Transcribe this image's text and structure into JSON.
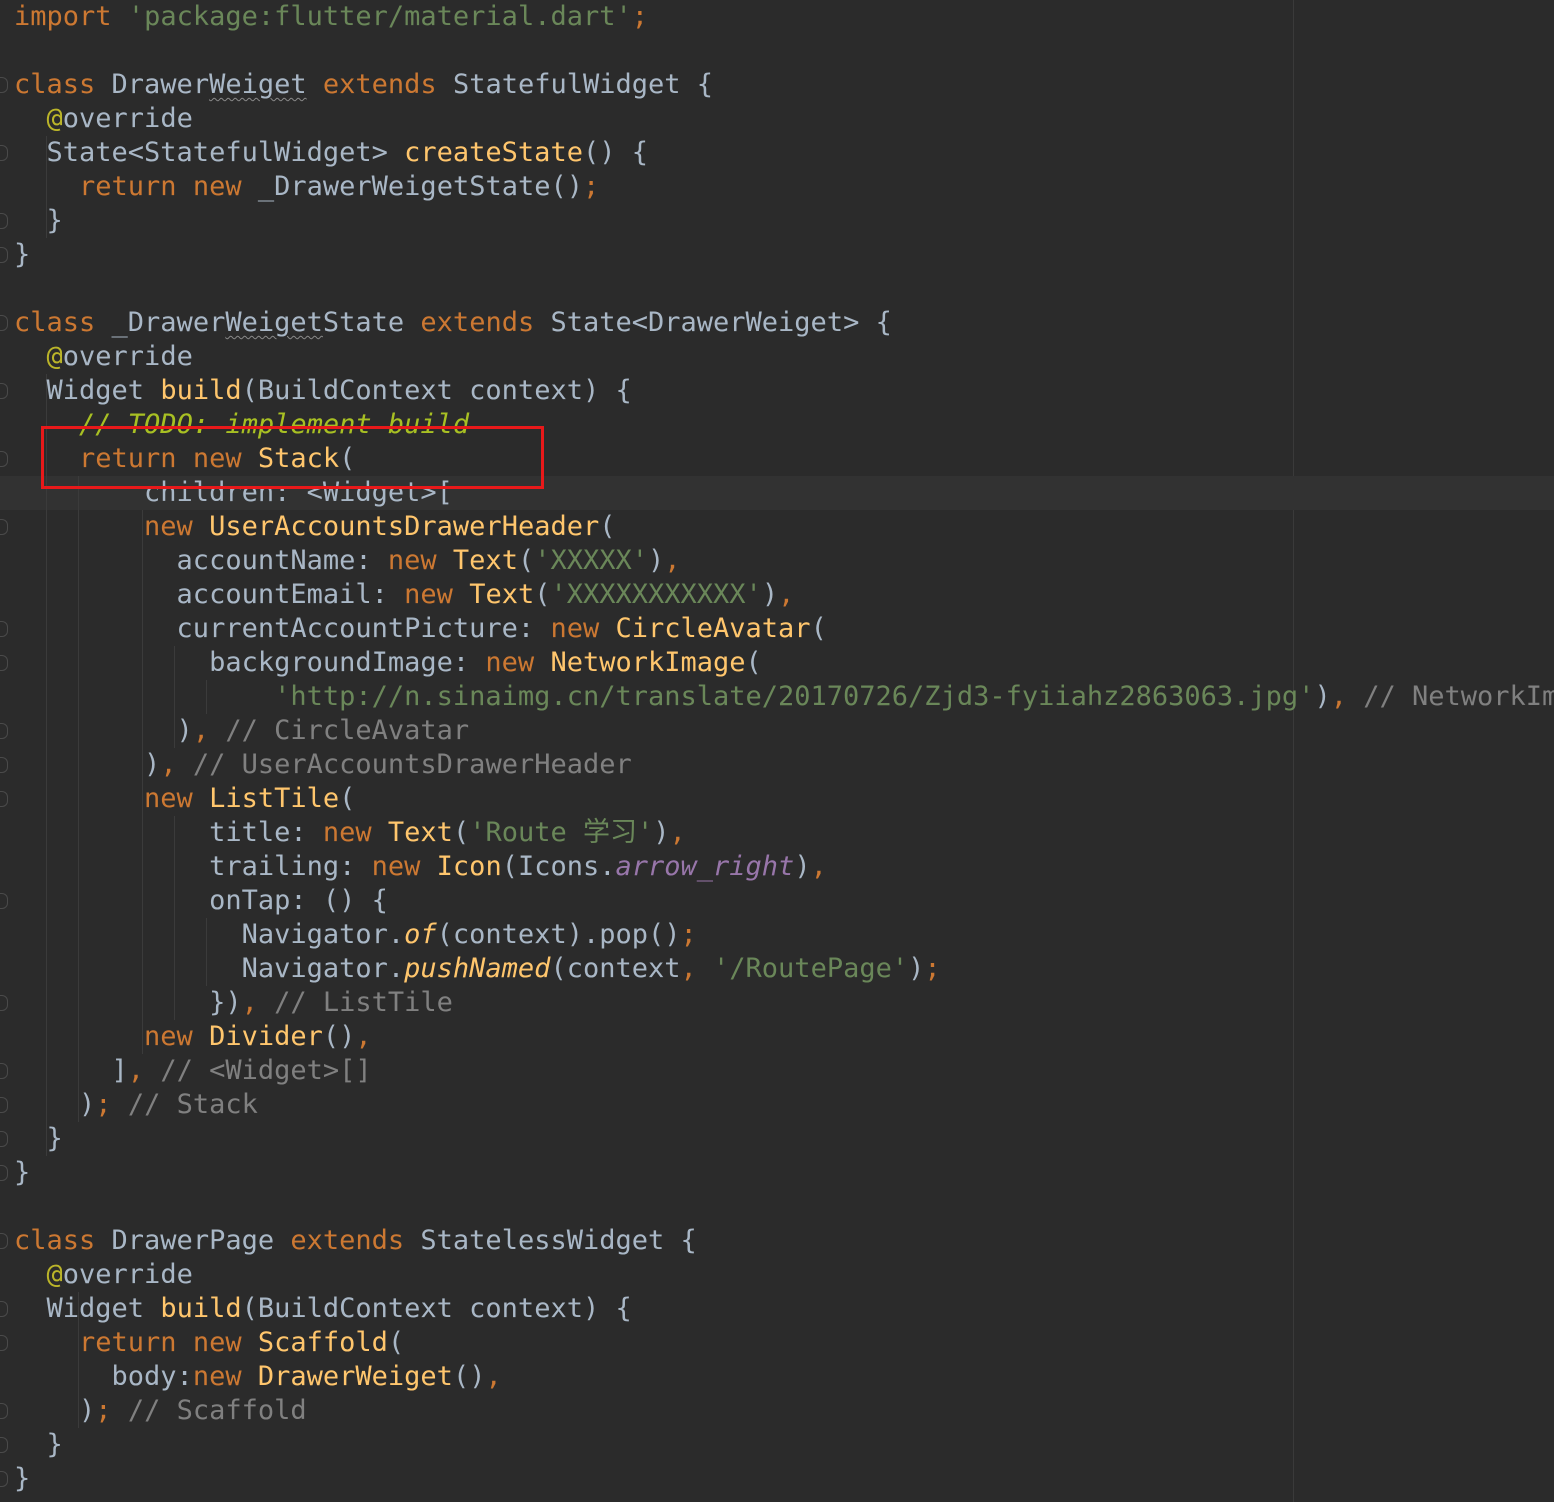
{
  "editor": {
    "language": "dart",
    "colors": {
      "background": "#2b2b2b",
      "keyword": "#cc7832",
      "string": "#6a8759",
      "comment": "#808080",
      "annotation": "#bbb529",
      "function": "#ffc66d",
      "todo": "#a8c023",
      "field": "#9876aa",
      "plain": "#a9b7c6",
      "highlight_box": "#e8191a"
    },
    "lines": [
      [
        {
          "t": "import",
          "c": "kw"
        },
        {
          "t": " "
        },
        {
          "t": "'package:flutter/material.dart'",
          "c": "str"
        },
        {
          "t": ";",
          "c": "kw"
        }
      ],
      [],
      [
        {
          "t": "class",
          "c": "kw"
        },
        {
          "t": " Drawer"
        },
        {
          "t": "Weiget",
          "c": "ul"
        },
        {
          "t": " "
        },
        {
          "t": "extends",
          "c": "kw"
        },
        {
          "t": " StatefulWidget {"
        }
      ],
      [
        {
          "t": "  "
        },
        {
          "t": "@",
          "c": "ann"
        },
        {
          "t": "override"
        }
      ],
      [
        {
          "t": "  State<StatefulWidget> "
        },
        {
          "t": "createState",
          "c": "fn"
        },
        {
          "t": "() {"
        }
      ],
      [
        {
          "t": "    "
        },
        {
          "t": "return",
          "c": "kw"
        },
        {
          "t": " "
        },
        {
          "t": "new",
          "c": "kw"
        },
        {
          "t": " _DrawerWeigetState()"
        },
        {
          "t": ";",
          "c": "kw"
        }
      ],
      [
        {
          "t": "  }"
        }
      ],
      [
        {
          "t": "}"
        }
      ],
      [],
      [
        {
          "t": "class",
          "c": "kw"
        },
        {
          "t": " _Drawer"
        },
        {
          "t": "Weiget",
          "c": "ul"
        },
        {
          "t": "State "
        },
        {
          "t": "extends",
          "c": "kw"
        },
        {
          "t": " State<DrawerWeiget> {"
        }
      ],
      [
        {
          "t": "  "
        },
        {
          "t": "@",
          "c": "ann"
        },
        {
          "t": "override"
        }
      ],
      [
        {
          "t": "  Widget "
        },
        {
          "t": "build",
          "c": "fn"
        },
        {
          "t": "(BuildContext context) {"
        }
      ],
      [
        {
          "t": "    "
        },
        {
          "t": "// TODO: implement build",
          "c": "todo"
        }
      ],
      [
        {
          "t": "    "
        },
        {
          "t": "return",
          "c": "kw"
        },
        {
          "t": " "
        },
        {
          "t": "new",
          "c": "kw"
        },
        {
          "t": " "
        },
        {
          "t": "Stack",
          "c": "fn"
        },
        {
          "t": "("
        }
      ],
      [
        {
          "t": "        children: <Widget>["
        }
      ],
      [
        {
          "t": "        "
        },
        {
          "t": "new",
          "c": "kw"
        },
        {
          "t": " "
        },
        {
          "t": "UserAccountsDrawerHeader",
          "c": "fn"
        },
        {
          "t": "("
        }
      ],
      [
        {
          "t": "          accountName: "
        },
        {
          "t": "new",
          "c": "kw"
        },
        {
          "t": " "
        },
        {
          "t": "Text",
          "c": "fn"
        },
        {
          "t": "("
        },
        {
          "t": "'XXXXX'",
          "c": "str"
        },
        {
          "t": ")"
        },
        {
          "t": ",",
          "c": "kw"
        }
      ],
      [
        {
          "t": "          accountEmail: "
        },
        {
          "t": "new",
          "c": "kw"
        },
        {
          "t": " "
        },
        {
          "t": "Text",
          "c": "fn"
        },
        {
          "t": "("
        },
        {
          "t": "'XXXXXXXXXXX'",
          "c": "str"
        },
        {
          "t": ")"
        },
        {
          "t": ",",
          "c": "kw"
        }
      ],
      [
        {
          "t": "          currentAccountPicture: "
        },
        {
          "t": "new",
          "c": "kw"
        },
        {
          "t": " "
        },
        {
          "t": "CircleAvatar",
          "c": "fn"
        },
        {
          "t": "("
        }
      ],
      [
        {
          "t": "            backgroundImage: "
        },
        {
          "t": "new",
          "c": "kw"
        },
        {
          "t": " "
        },
        {
          "t": "NetworkImage",
          "c": "fn"
        },
        {
          "t": "("
        }
      ],
      [
        {
          "t": "                "
        },
        {
          "t": "'http://n.sinaimg.cn/translate/20170726/Zjd3-fyiiahz2863063.jpg'",
          "c": "str"
        },
        {
          "t": ")"
        },
        {
          "t": ",",
          "c": "kw"
        },
        {
          "t": " "
        },
        {
          "t": "// NetworkImage",
          "c": "cm"
        }
      ],
      [
        {
          "t": "          )"
        },
        {
          "t": ",",
          "c": "kw"
        },
        {
          "t": " "
        },
        {
          "t": "// CircleAvatar",
          "c": "cm"
        }
      ],
      [
        {
          "t": "        )"
        },
        {
          "t": ",",
          "c": "kw"
        },
        {
          "t": " "
        },
        {
          "t": "// UserAccountsDrawerHeader",
          "c": "cm"
        }
      ],
      [
        {
          "t": "        "
        },
        {
          "t": "new",
          "c": "kw"
        },
        {
          "t": " "
        },
        {
          "t": "ListTile",
          "c": "fn"
        },
        {
          "t": "("
        }
      ],
      [
        {
          "t": "            title: "
        },
        {
          "t": "new",
          "c": "kw"
        },
        {
          "t": " "
        },
        {
          "t": "Text",
          "c": "fn"
        },
        {
          "t": "("
        },
        {
          "t": "'Route 学习'",
          "c": "str"
        },
        {
          "t": ")"
        },
        {
          "t": ",",
          "c": "kw"
        }
      ],
      [
        {
          "t": "            trailing: "
        },
        {
          "t": "new",
          "c": "kw"
        },
        {
          "t": " "
        },
        {
          "t": "Icon",
          "c": "fn"
        },
        {
          "t": "(Icons."
        },
        {
          "t": "arrow_right",
          "c": "field"
        },
        {
          "t": ")"
        },
        {
          "t": ",",
          "c": "kw"
        }
      ],
      [
        {
          "t": "            onTap: () {"
        }
      ],
      [
        {
          "t": "              Navigator."
        },
        {
          "t": "of",
          "c": "smeth"
        },
        {
          "t": "(context).pop()"
        },
        {
          "t": ";",
          "c": "kw"
        }
      ],
      [
        {
          "t": "              Navigator."
        },
        {
          "t": "pushNamed",
          "c": "smeth"
        },
        {
          "t": "(context"
        },
        {
          "t": ",",
          "c": "kw"
        },
        {
          "t": " "
        },
        {
          "t": "'/RoutePage'",
          "c": "str"
        },
        {
          "t": ")"
        },
        {
          "t": ";",
          "c": "kw"
        }
      ],
      [
        {
          "t": "            })"
        },
        {
          "t": ",",
          "c": "kw"
        },
        {
          "t": " "
        },
        {
          "t": "// ListTile",
          "c": "cm"
        }
      ],
      [
        {
          "t": "        "
        },
        {
          "t": "new",
          "c": "kw"
        },
        {
          "t": " "
        },
        {
          "t": "Divider",
          "c": "fn"
        },
        {
          "t": "()"
        },
        {
          "t": ",",
          "c": "kw"
        }
      ],
      [
        {
          "t": "      ]"
        },
        {
          "t": ",",
          "c": "kw"
        },
        {
          "t": " "
        },
        {
          "t": "// <Widget>[]",
          "c": "cm"
        }
      ],
      [
        {
          "t": "    )"
        },
        {
          "t": ";",
          "c": "kw"
        },
        {
          "t": " "
        },
        {
          "t": "// Stack",
          "c": "cm"
        }
      ],
      [
        {
          "t": "  }"
        }
      ],
      [
        {
          "t": "}"
        }
      ],
      [],
      [
        {
          "t": "class",
          "c": "kw"
        },
        {
          "t": " DrawerPage "
        },
        {
          "t": "extends",
          "c": "kw"
        },
        {
          "t": " StatelessWidget {"
        }
      ],
      [
        {
          "t": "  "
        },
        {
          "t": "@",
          "c": "ann"
        },
        {
          "t": "override"
        }
      ],
      [
        {
          "t": "  Widget "
        },
        {
          "t": "build",
          "c": "fn"
        },
        {
          "t": "(BuildContext context) {"
        }
      ],
      [
        {
          "t": "    "
        },
        {
          "t": "return",
          "c": "kw"
        },
        {
          "t": " "
        },
        {
          "t": "new",
          "c": "kw"
        },
        {
          "t": " "
        },
        {
          "t": "Scaffold",
          "c": "fn"
        },
        {
          "t": "("
        }
      ],
      [
        {
          "t": "      body:"
        },
        {
          "t": "new",
          "c": "kw"
        },
        {
          "t": " "
        },
        {
          "t": "DrawerWeiget",
          "c": "fn"
        },
        {
          "t": "()"
        },
        {
          "t": ",",
          "c": "kw"
        }
      ],
      [
        {
          "t": "    )"
        },
        {
          "t": ";",
          "c": "kw"
        },
        {
          "t": " "
        },
        {
          "t": "// Scaffold",
          "c": "cm"
        }
      ],
      [
        {
          "t": "  }"
        }
      ],
      [
        {
          "t": "}"
        }
      ]
    ]
  }
}
